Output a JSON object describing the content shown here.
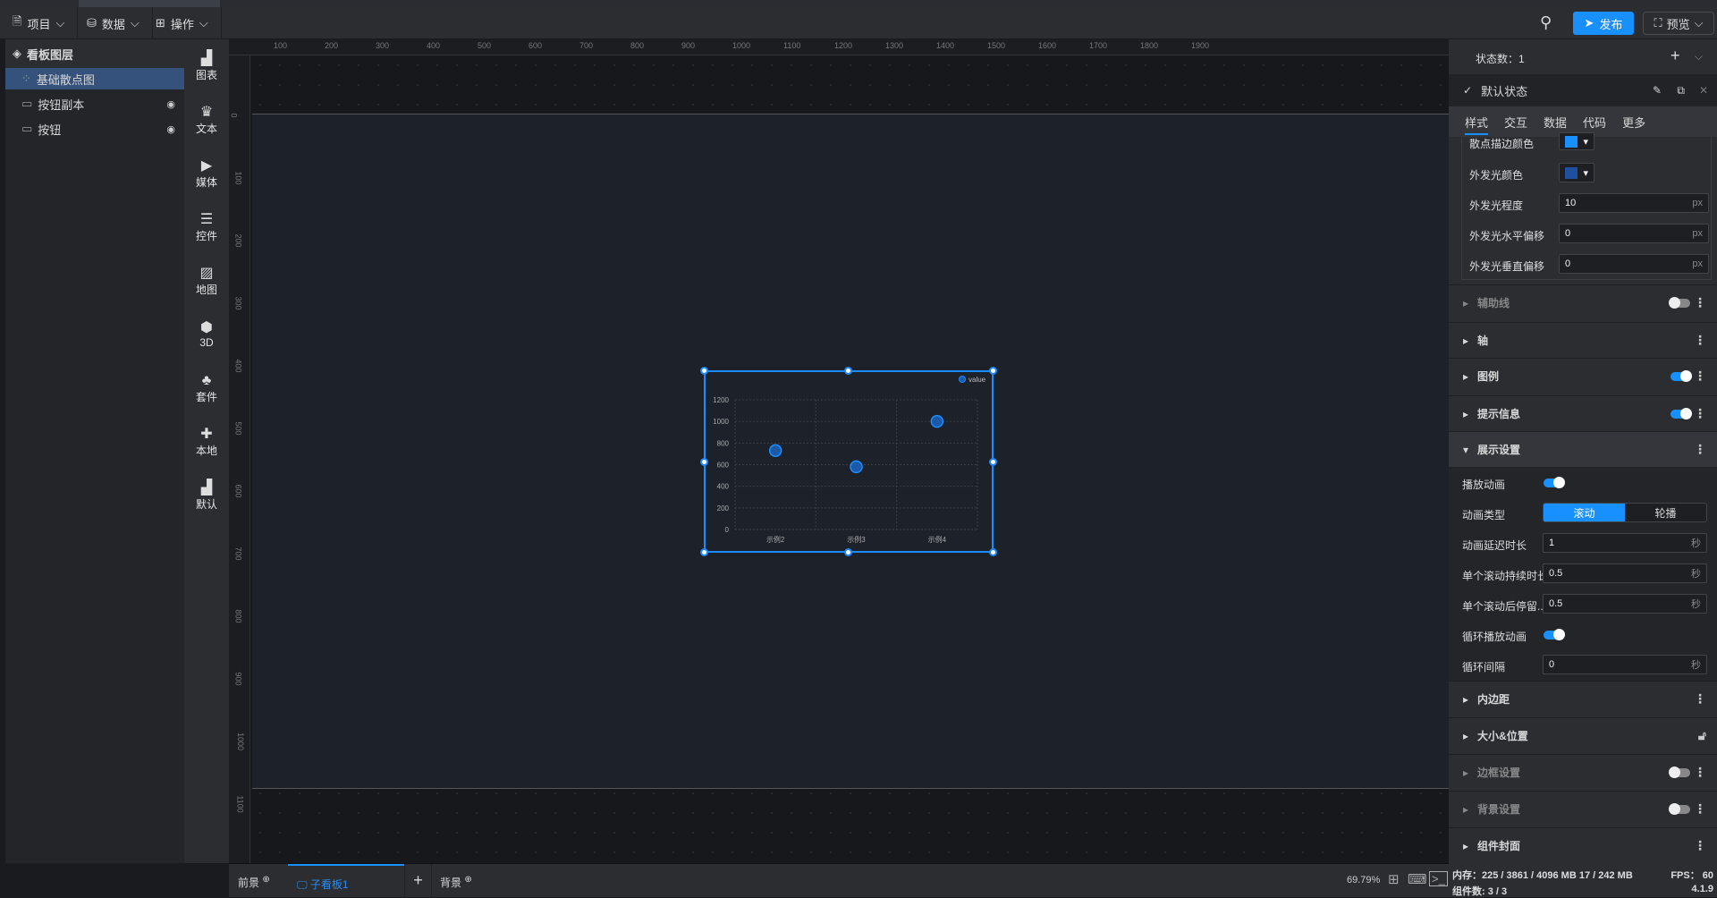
{
  "menu": {
    "project": "项目",
    "data": "数据",
    "ops": "操作",
    "publish": "发布",
    "preview": "预览"
  },
  "layers": {
    "title": "看板图层",
    "items": [
      {
        "label": "基础散点图"
      },
      {
        "label": "按钮副本"
      },
      {
        "label": "按钮"
      }
    ]
  },
  "components": [
    "图表",
    "文本",
    "媒体",
    "控件",
    "地图",
    "3D",
    "套件",
    "本地",
    "默认"
  ],
  "ruler": {
    "top": [
      "100",
      "200",
      "300",
      "400",
      "500",
      "600",
      "700",
      "800",
      "900",
      "1000",
      "1100",
      "1200",
      "1300",
      "1400",
      "1500",
      "1600",
      "1700",
      "1800",
      "1900"
    ],
    "left": [
      "0",
      "100",
      "200",
      "300",
      "400",
      "500",
      "600",
      "700",
      "800",
      "900",
      "1000",
      "1100"
    ]
  },
  "chart_data": {
    "type": "scatter",
    "categories": [
      "示例2",
      "示例3",
      "示例4"
    ],
    "series": [
      {
        "name": "value",
        "values": [
          730,
          580,
          1000
        ]
      }
    ],
    "ylim": [
      0,
      1200
    ],
    "yticks": [
      "0",
      "200",
      "400",
      "600",
      "800",
      "1000",
      "1200"
    ],
    "grid": true,
    "legend": "top-right",
    "color": "#1a6fd6"
  },
  "right": {
    "state_count": "状态数：1",
    "default_state": "默认状态",
    "tabs": [
      "样式",
      "交互",
      "数据",
      "代码",
      "更多"
    ],
    "style_rows": [
      {
        "label": "散点描边颜色",
        "color": "#1890ff"
      },
      {
        "label": "外发光颜色",
        "color": "#1e4fa0"
      },
      {
        "label": "外发光程度",
        "value": "10",
        "unit": "px"
      },
      {
        "label": "外发光水平偏移",
        "value": "0",
        "unit": "px"
      },
      {
        "label": "外发光垂直偏移",
        "value": "0",
        "unit": "px"
      }
    ],
    "sections": {
      "guide": "辅助线",
      "axis": "轴",
      "legend": "图例",
      "tooltip": "提示信息",
      "display": "展示设置",
      "padding": "内边距",
      "size": "大小&位置",
      "border": "边框设置",
      "bg": "背景设置",
      "cover": "组件封面"
    },
    "display": {
      "play": "播放动画",
      "anim_type": "动画类型",
      "opt_scroll": "滚动",
      "opt_carousel": "轮播",
      "delay": "动画延迟时长",
      "delay_v": "1",
      "dur": "单个滚动持续时长",
      "dur_v": "0.5",
      "stay": "单个滚动后停留...",
      "stay_v": "0.5",
      "loop": "循环播放动画",
      "interval": "循环间隔",
      "interval_v": "0",
      "unit": "秒"
    }
  },
  "bottom": {
    "front": "前景",
    "board": "子看板1",
    "back": "背景",
    "zoom": "69.79%"
  },
  "status": {
    "memory": "内存：225 / 3861 / 4096 MB  17 / 242 MB",
    "fps": "FPS：  60",
    "count": "组件数: 3 / 3",
    "version": "4.1.9"
  }
}
